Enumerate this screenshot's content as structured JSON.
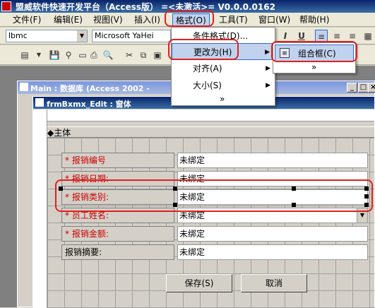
{
  "window": {
    "title": "盟威软件快速开发平台（Access版） =<未激活>= V0.0.0.0162"
  },
  "menubar": [
    {
      "label": "文件(F)"
    },
    {
      "label": "编辑(E)"
    },
    {
      "label": "视图(V)"
    },
    {
      "label": "插入(I)"
    },
    {
      "label": "格式(O)"
    },
    {
      "label": "工具(T)"
    },
    {
      "label": "窗口(W)"
    },
    {
      "label": "帮助(H)"
    }
  ],
  "toolbar": {
    "object_combo": "lbmc",
    "font_combo": "Microsoft YaHei",
    "italic_label": "I",
    "underline_label": "U"
  },
  "format_menu": {
    "items": [
      {
        "label": "条件格式(D)..."
      },
      {
        "label": "更改为(H)"
      },
      {
        "label": "对齐(A)"
      },
      {
        "label": "大小(S)"
      },
      {
        "label": "»"
      }
    ]
  },
  "change_to_menu": {
    "items": [
      {
        "label": "组合框(C)"
      },
      {
        "label": "»"
      }
    ]
  },
  "db_window": {
    "title": "Main : 数据库 (Access 2002 -"
  },
  "form_window": {
    "title": "frmBxmx_Edit : 窗体",
    "section": "◆主体"
  },
  "form": {
    "fields": [
      {
        "star": "*",
        "label": "报销编号",
        "value": "未绑定"
      },
      {
        "star": "*",
        "label": "报销日期:",
        "value": "未绑定"
      },
      {
        "star": "*",
        "label": "报销类别:",
        "value": "未绑定"
      },
      {
        "star": "*",
        "label": "员工姓名:",
        "value": "未绑定"
      },
      {
        "star": "*",
        "label": "报销金额:",
        "value": "未绑定"
      },
      {
        "star": "",
        "label": "报销摘要:",
        "value": "未绑定"
      }
    ],
    "save_label": "保存(S)",
    "cancel_label": "取消"
  },
  "colors": {
    "accent": "#316ac5",
    "highlight_box": "#e02020"
  }
}
